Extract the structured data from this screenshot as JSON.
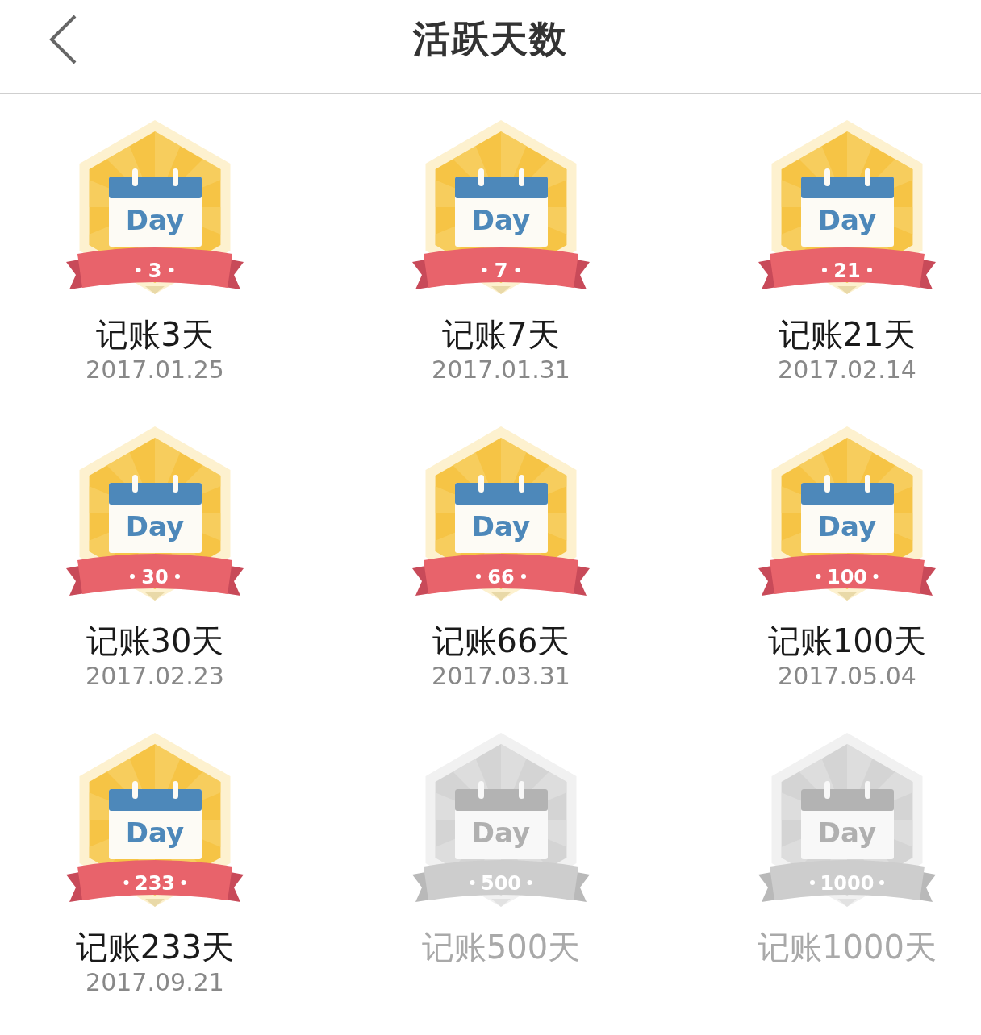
{
  "header": {
    "title": "活跃天数"
  },
  "badges": [
    {
      "day_label": "Day",
      "number": "3",
      "title": "记账3天",
      "date": "2017.01.25",
      "unlocked": true
    },
    {
      "day_label": "Day",
      "number": "7",
      "title": "记账7天",
      "date": "2017.01.31",
      "unlocked": true
    },
    {
      "day_label": "Day",
      "number": "21",
      "title": "记账21天",
      "date": "2017.02.14",
      "unlocked": true
    },
    {
      "day_label": "Day",
      "number": "30",
      "title": "记账30天",
      "date": "2017.02.23",
      "unlocked": true
    },
    {
      "day_label": "Day",
      "number": "66",
      "title": "记账66天",
      "date": "2017.03.31",
      "unlocked": true
    },
    {
      "day_label": "Day",
      "number": "100",
      "title": "记账100天",
      "date": "2017.05.04",
      "unlocked": true
    },
    {
      "day_label": "Day",
      "number": "233",
      "title": "记账233天",
      "date": "2017.09.21",
      "unlocked": true
    },
    {
      "day_label": "Day",
      "number": "500",
      "title": "记账500天",
      "unlocked": false
    },
    {
      "day_label": "Day",
      "number": "1000",
      "title": "记账1000天",
      "unlocked": false
    }
  ]
}
